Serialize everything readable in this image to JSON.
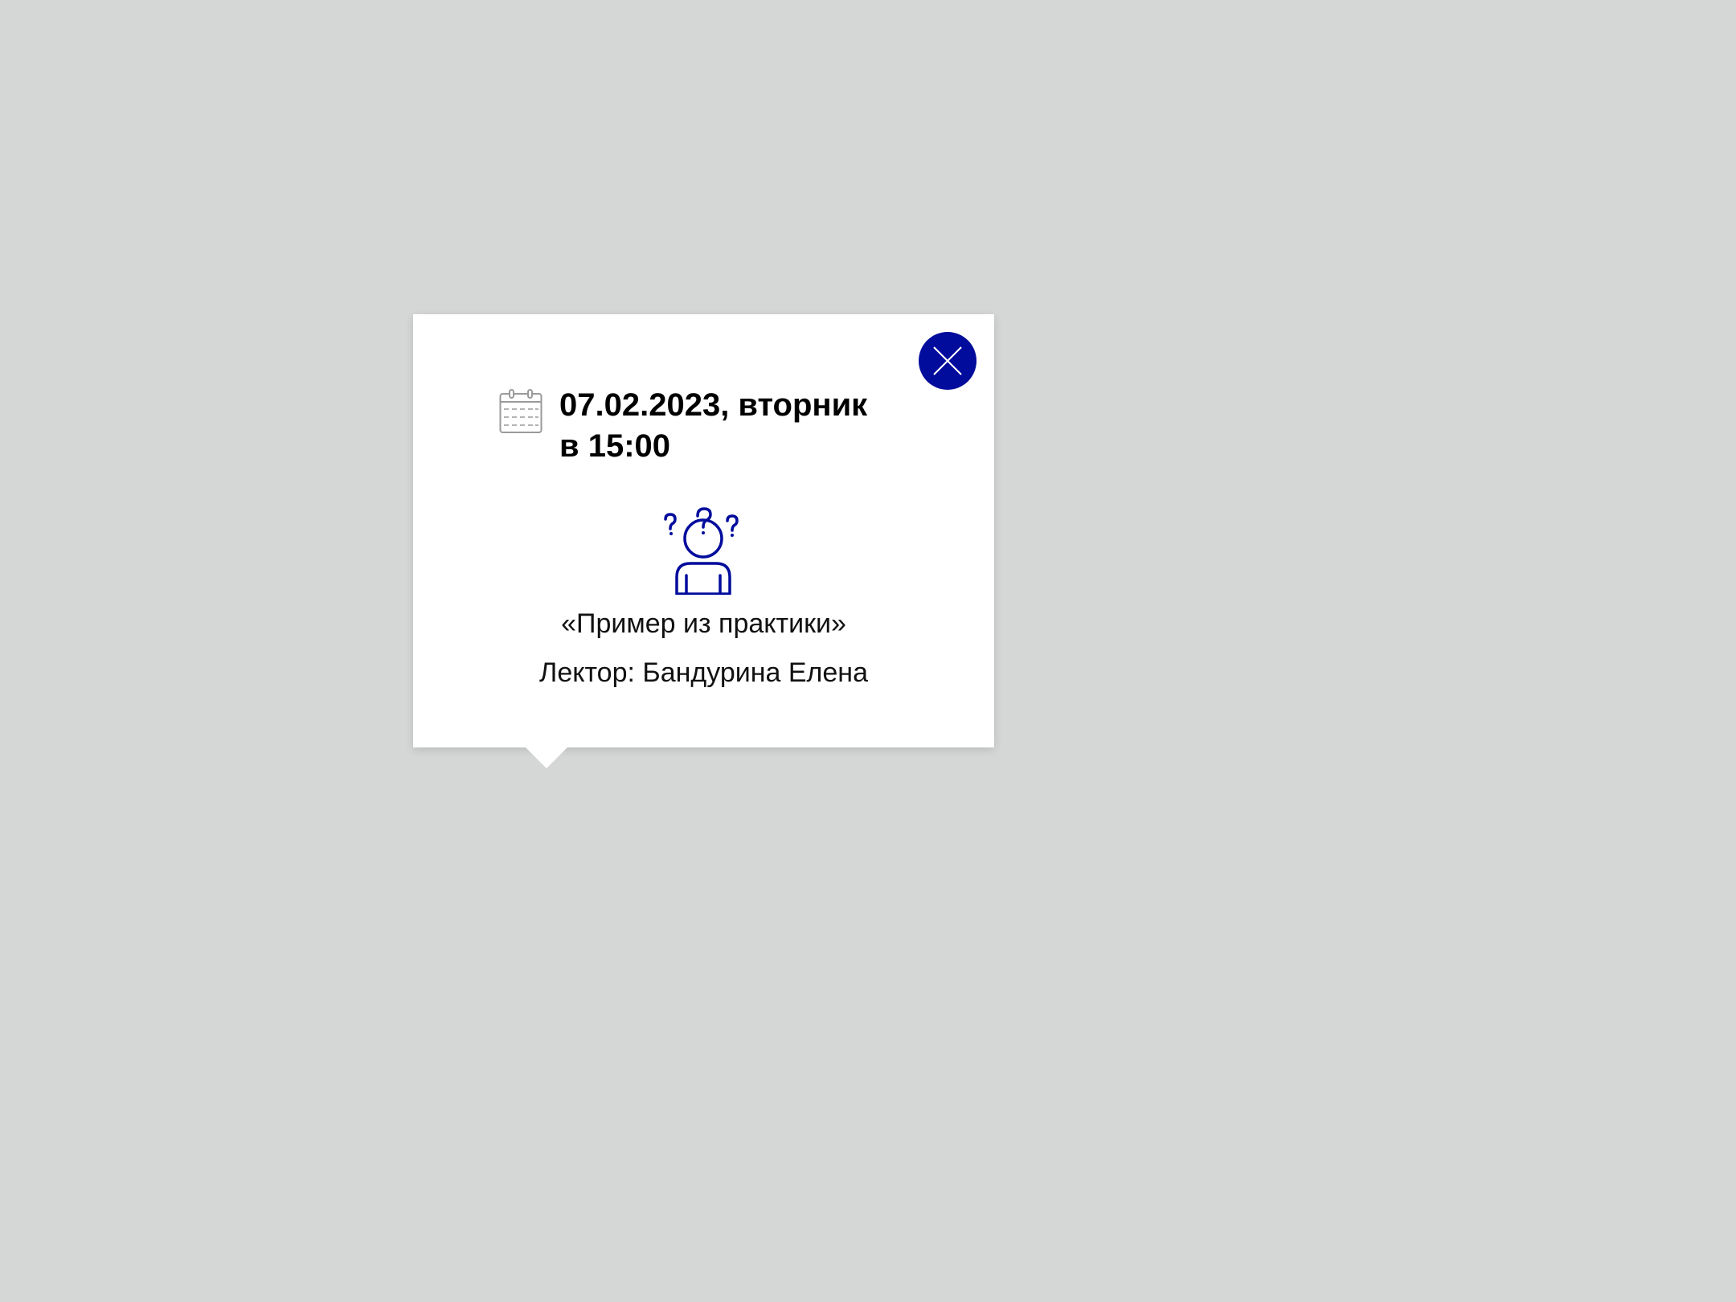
{
  "popup": {
    "date_line": "07.02.2023, вторник",
    "time_line": "в 15:00",
    "event_title": "«Пример из практики»",
    "lecturer": "Лектор: Бандурина Елена",
    "icons": {
      "close": "close-icon",
      "calendar": "calendar-icon",
      "person": "confused-person-icon"
    }
  },
  "colors": {
    "background": "#d5d7d6",
    "accent": "#020c9c",
    "card": "#ffffff"
  }
}
